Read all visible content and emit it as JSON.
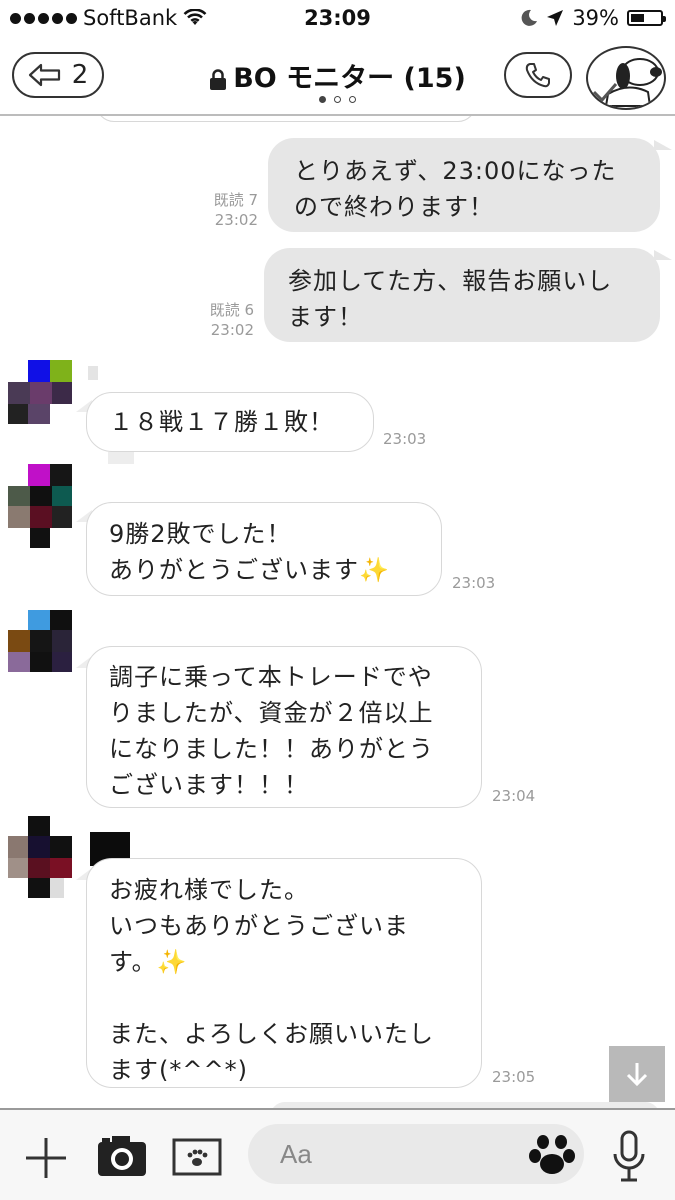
{
  "status_bar": {
    "carrier": "SoftBank",
    "time": "23:09",
    "battery": "39%"
  },
  "header": {
    "back_count": "2",
    "title": "BO モニター (15)"
  },
  "messages": [
    {
      "direction": "out",
      "read": "既読 7",
      "time": "23:02",
      "text": "とりあえず、23:00になった\nので終わります！"
    },
    {
      "direction": "out",
      "read": "既読 6",
      "time": "23:02",
      "text": "参加してた方、報告お願いし\nます！"
    },
    {
      "direction": "in",
      "time": "23:03",
      "text": "１８戦１７勝１敗！"
    },
    {
      "direction": "in",
      "time": "23:03",
      "text": "9勝2敗でした！\nありがとうございます✨"
    },
    {
      "direction": "in",
      "time": "23:04",
      "text": "調子に乗って本トレードでや\nりましたが、資金が２倍以上\nになりました！！ありがとう\nございます！！！"
    },
    {
      "direction": "in",
      "time": "23:05",
      "text": "お疲れ様でした。\nいつもありがとうございま\nす。✨\n\nまた、よろしくお願いいたし\nます(*^^*)"
    }
  ],
  "input": {
    "placeholder": "Aa"
  },
  "colors": {
    "outgoing_bubble": "#e6e6e6",
    "incoming_bubble": "#ffffff",
    "meta_text": "#9a9a9a"
  },
  "icons": [
    "wifi-icon",
    "moon-icon",
    "location-arrow-icon",
    "battery-icon",
    "back-arrow-icon",
    "lock-icon",
    "phone-icon",
    "group-avatar-icon",
    "down-arrow-icon",
    "plus-icon",
    "camera-icon",
    "photo-icon",
    "sticker-paw-icon",
    "mic-icon"
  ]
}
